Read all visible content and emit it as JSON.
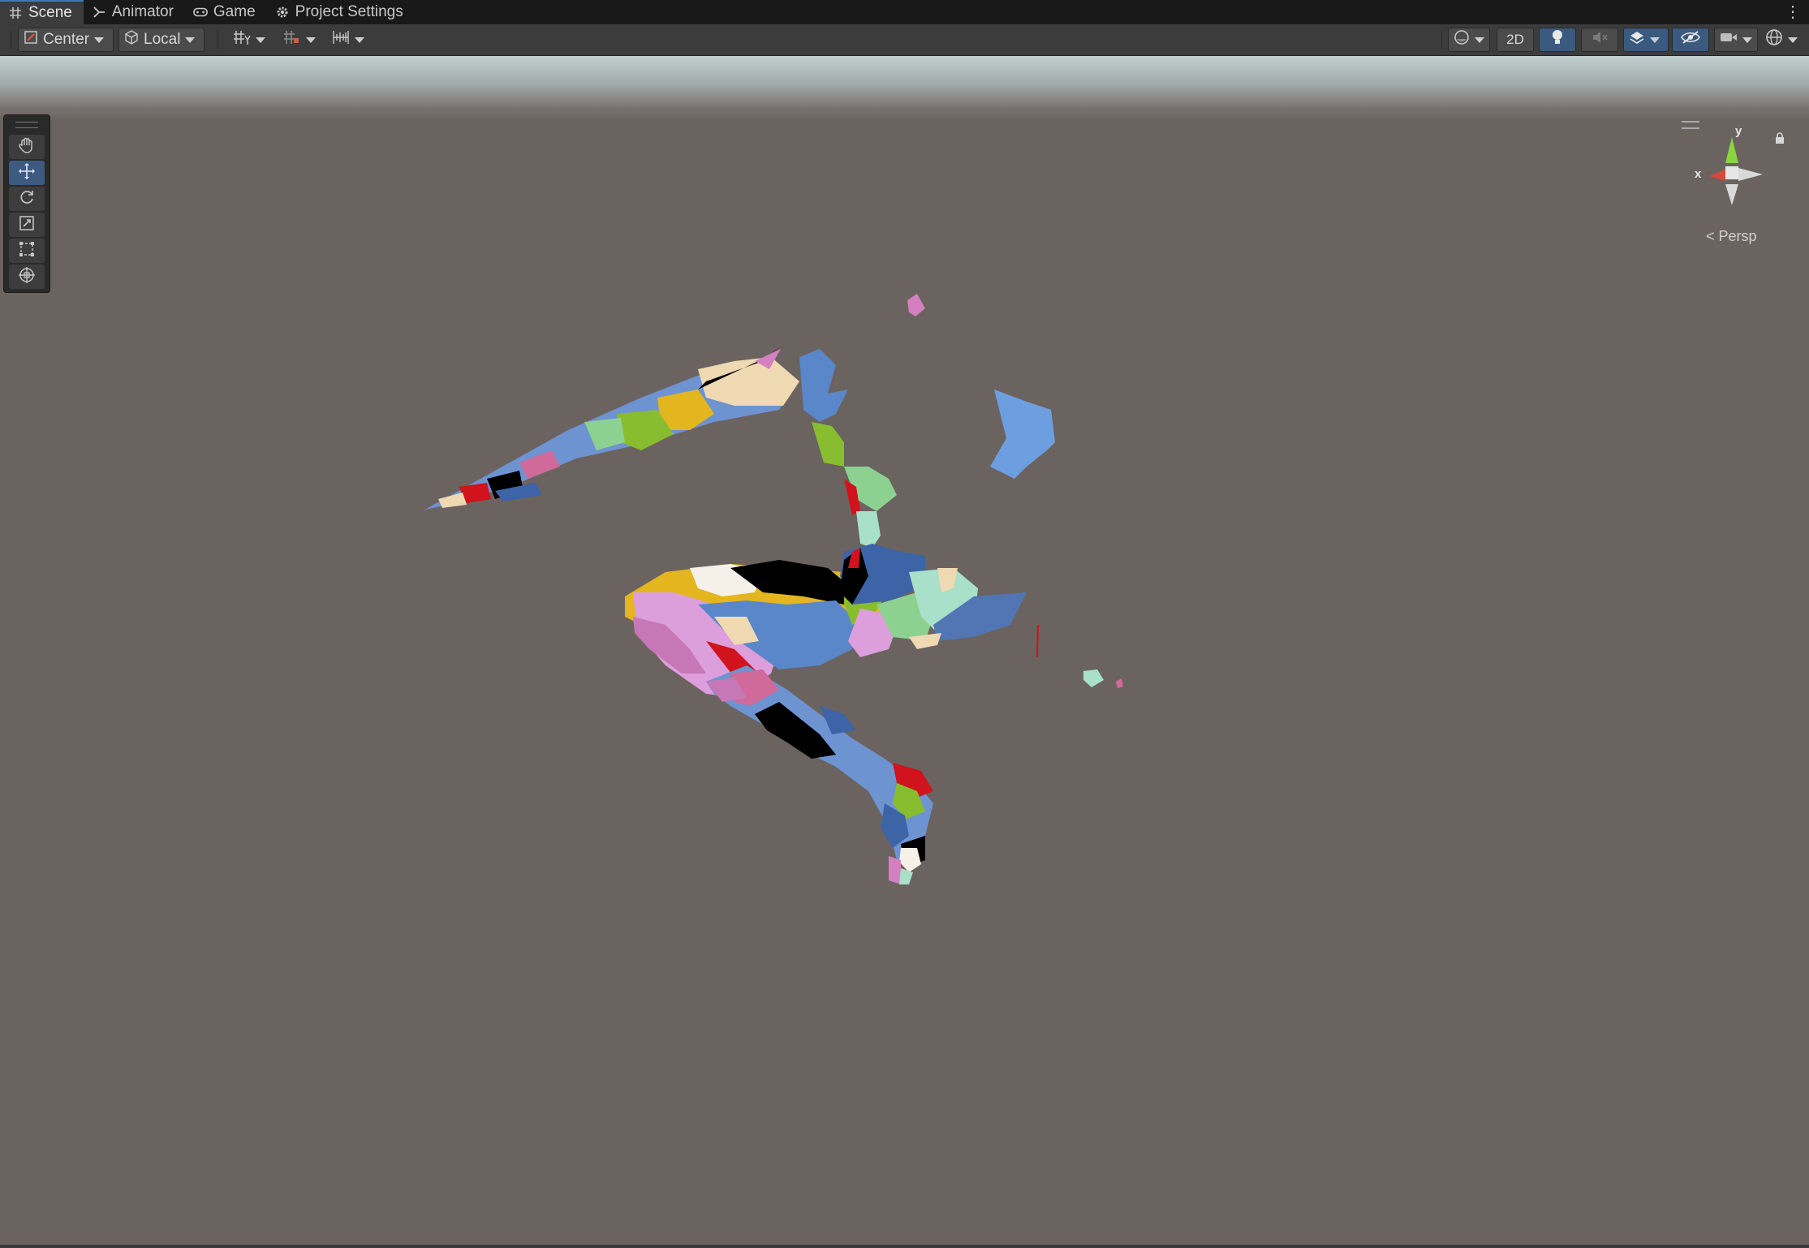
{
  "tabs": [
    {
      "label": "Scene",
      "icon": "grid-icon",
      "active": true
    },
    {
      "label": "Animator",
      "icon": "animator-icon",
      "active": false
    },
    {
      "label": "Game",
      "icon": "gamepad-icon",
      "active": false
    },
    {
      "label": "Project Settings",
      "icon": "gear-icon",
      "active": false
    }
  ],
  "toolbar": {
    "pivot_mode": "Center",
    "pivot_rotation": "Local",
    "two_d_label": "2D"
  },
  "gizmo": {
    "y_label": "y",
    "x_label": "x",
    "projection_label": "Persp"
  },
  "tools": [
    "hand-tool",
    "move-tool",
    "rotate-tool",
    "scale-tool",
    "rect-tool",
    "transform-tool"
  ],
  "colors": {
    "viewport_bg": "#6b6360",
    "accent": "#3a79bb",
    "axis_x": "#d9463a",
    "axis_y": "#8ad53e"
  }
}
